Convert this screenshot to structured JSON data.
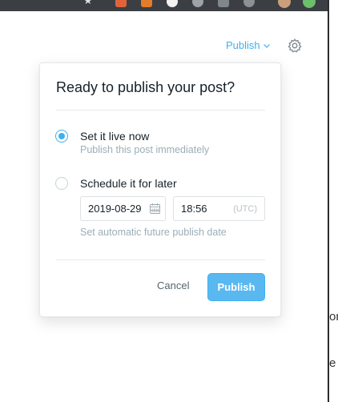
{
  "header": {
    "publish_trigger_label": "Publish",
    "accent_color": "#3eb0ef"
  },
  "popover": {
    "title": "Ready to publish your post?",
    "options": [
      {
        "label": "Set it live now",
        "description": "Publish this post immediately",
        "selected": true
      },
      {
        "label": "Schedule it for later",
        "description": "Set automatic future publish date",
        "selected": false
      }
    ],
    "schedule": {
      "date_value": "2019-08-29",
      "time_value": "18:56",
      "timezone": "(UTC)"
    },
    "cancel_label": "Cancel",
    "publish_label": "Publish"
  },
  "icons": {
    "gear": "gear-icon",
    "chevron": "chevron-down-icon",
    "calendar": "calendar-icon"
  },
  "background_fragments": {
    "line1": "or",
    "line2": "e"
  }
}
